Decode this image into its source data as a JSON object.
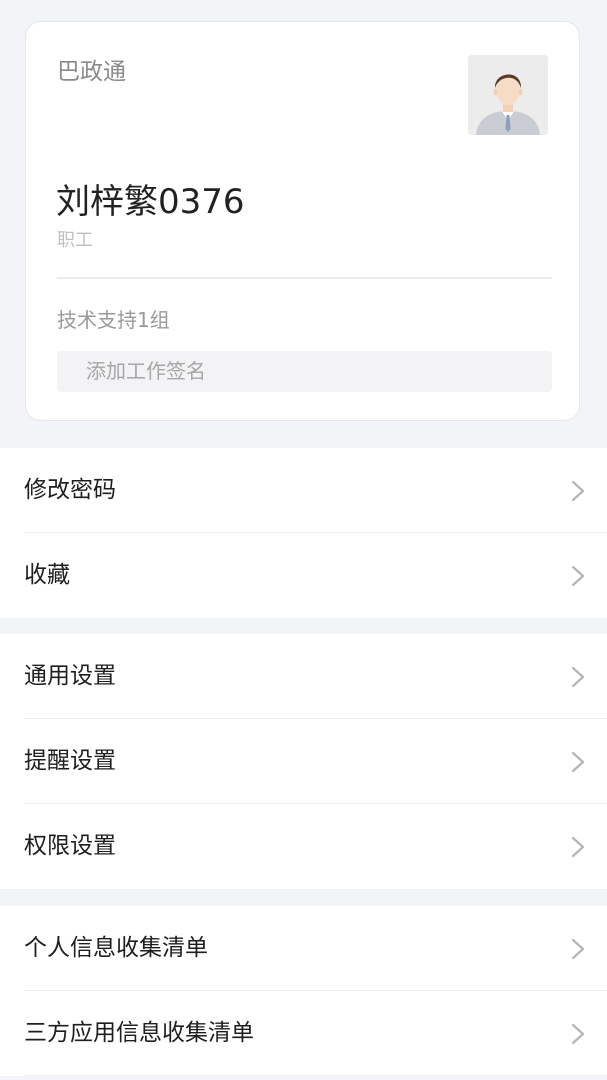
{
  "profile": {
    "org": "巴政通",
    "name": "刘梓繁0376",
    "role": "职工",
    "department": "技术支持1组",
    "signature_placeholder": "添加工作签名"
  },
  "menu_groups": [
    {
      "items": [
        {
          "label": "修改密码"
        },
        {
          "label": "收藏"
        }
      ]
    },
    {
      "items": [
        {
          "label": "通用设置"
        },
        {
          "label": "提醒设置"
        },
        {
          "label": "权限设置"
        }
      ]
    },
    {
      "items": [
        {
          "label": "个人信息收集清单"
        },
        {
          "label": "三方应用信息收集清单"
        }
      ]
    }
  ],
  "colors": {
    "page_bg": "#f3f4f8",
    "card_bg": "#ffffff",
    "chevron": "#b5b5b5"
  }
}
